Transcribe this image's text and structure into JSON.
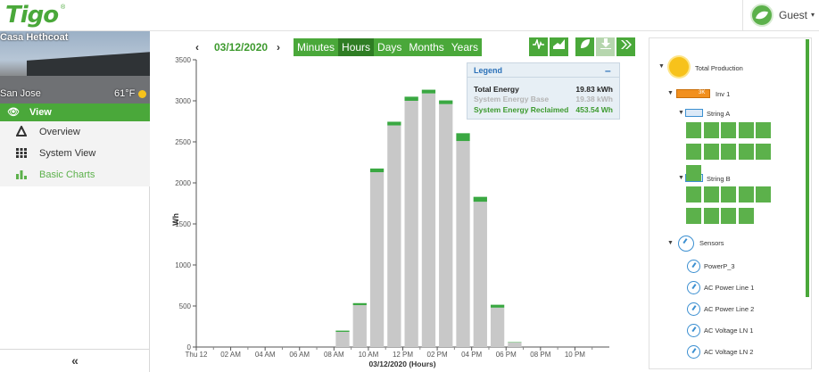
{
  "header": {
    "logo": "Tigo",
    "logo_reg": "®",
    "user": "Guest",
    "user_caret": "▾"
  },
  "sidebar": {
    "site_name": "Casa Hethcoat",
    "city": "San Jose",
    "temperature": "61°F",
    "view_label": "View",
    "items": [
      {
        "label": "Overview",
        "icon": "triangle-icon"
      },
      {
        "label": "System View",
        "icon": "grid-icon"
      },
      {
        "label": "Basic Charts",
        "icon": "bar-chart-icon"
      }
    ],
    "collapse_glyph": "«"
  },
  "toolbar": {
    "prev": "‹",
    "date": "03/12/2020",
    "next": "›",
    "tabs": [
      {
        "label": "Minutes",
        "active": false
      },
      {
        "label": "Hours",
        "active": true
      },
      {
        "label": "Days",
        "active": false
      },
      {
        "label": "Months",
        "active": false
      },
      {
        "label": "Years",
        "active": false
      }
    ],
    "tool_icons": [
      "pulse-icon",
      "area-chart-icon",
      "leaf-icon",
      "download-icon",
      "forward-icon"
    ]
  },
  "legend": {
    "title": "Legend",
    "collapse": "–",
    "rows": [
      {
        "label": "Total Energy",
        "value": "19.83 kWh"
      },
      {
        "label": "System Energy Base",
        "value": "19.38 kWh"
      },
      {
        "label": "System Energy Reclaimed",
        "value": "453.54 Wh"
      }
    ]
  },
  "chart_data": {
    "type": "bar",
    "stacked": true,
    "xlabel": "03/12/2020 (Hours)",
    "ylabel": "Wh",
    "ylim": [
      0,
      3500
    ],
    "yticks": [
      0,
      500,
      1000,
      1500,
      2000,
      2500,
      3000,
      3500
    ],
    "xtick_labels": [
      "Thu 12",
      "02 AM",
      "04 AM",
      "06 AM",
      "08 AM",
      "10 AM",
      "12 PM",
      "02 PM",
      "04 PM",
      "06 PM",
      "08 PM",
      "10 PM"
    ],
    "categories": [
      "00",
      "01",
      "02",
      "03",
      "04",
      "05",
      "06",
      "07",
      "08",
      "09",
      "10",
      "11",
      "12",
      "13",
      "14",
      "15",
      "16",
      "17",
      "18",
      "19",
      "20",
      "21",
      "22",
      "23"
    ],
    "series": [
      {
        "name": "System Energy Base",
        "color": "#c8c8c8",
        "values": [
          0,
          0,
          0,
          0,
          0,
          0,
          0,
          0,
          185,
          510,
          2130,
          2700,
          3000,
          3090,
          2960,
          2510,
          1770,
          480,
          55,
          0,
          0,
          0,
          0,
          0
        ]
      },
      {
        "name": "System Energy Reclaimed",
        "color": "#3aa842",
        "values": [
          0,
          0,
          0,
          0,
          0,
          0,
          0,
          0,
          15,
          25,
          45,
          45,
          50,
          45,
          45,
          95,
          60,
          35,
          5,
          0,
          0,
          0,
          0,
          0
        ]
      }
    ],
    "grid": false
  },
  "tree": {
    "total": "Total Production",
    "inverter": "Inv 1",
    "inverter_badge": "3K",
    "string_a": "String A",
    "string_a_panels": 11,
    "string_b": "String B",
    "string_b_panels": 9,
    "sensors": "Sensors",
    "sensor_items": [
      "PowerP_3",
      "AC Power Line 1",
      "AC Power Line 2",
      "AC Voltage LN 1",
      "AC Voltage LN 2"
    ]
  },
  "colors": {
    "accent": "#4aa83a",
    "accent_dark": "#2f7d24",
    "base_bar": "#c8c8c8",
    "reclaimed_bar": "#3aa842"
  }
}
